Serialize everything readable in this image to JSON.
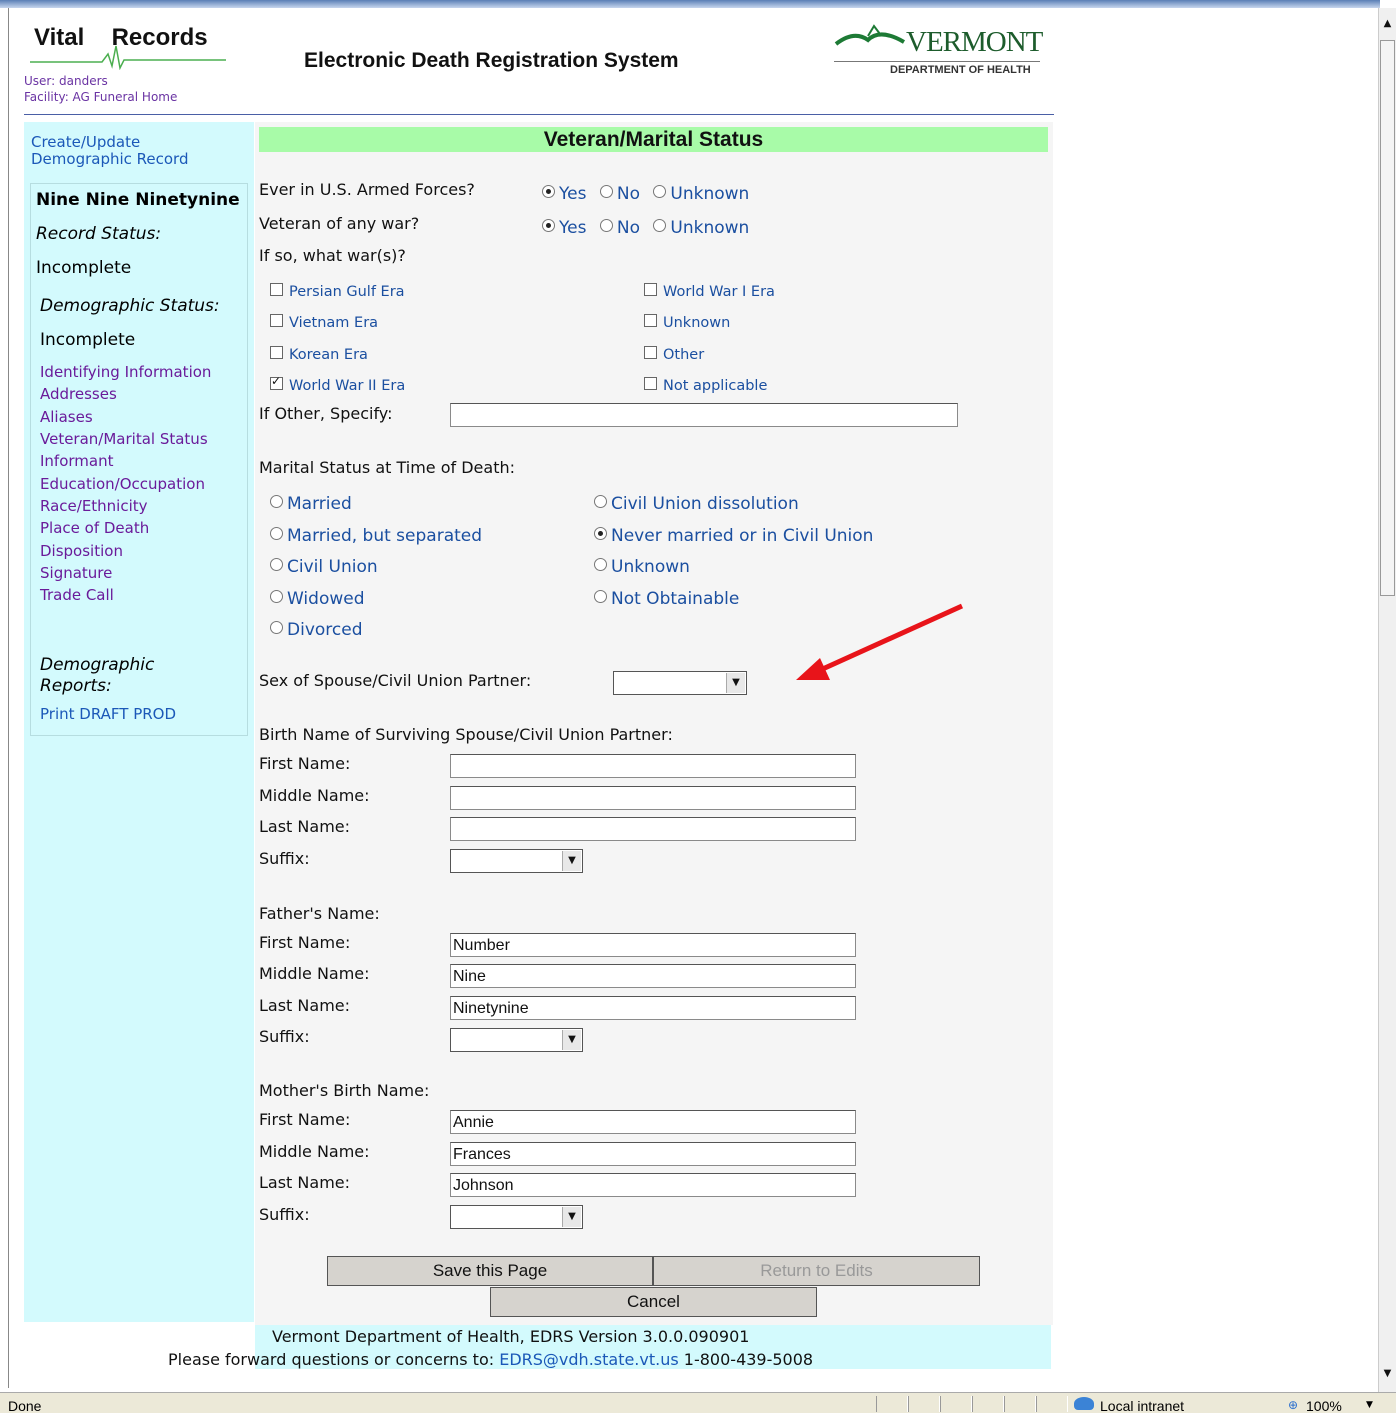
{
  "header": {
    "logo_left": "Vital",
    "logo_right": "Records",
    "user_line": "User: danders",
    "facility_line": "Facility: AG Funeral Home",
    "system_title": "Electronic Death Registration System",
    "state_name": "VERMONT",
    "department": "DEPARTMENT OF HEALTH"
  },
  "sidebar": {
    "create_link_1": "Create/Update",
    "create_link_2": "Demographic Record",
    "decedent_name": "Nine Nine Ninetynine",
    "record_status_label": "Record Status:",
    "record_status_value": "Incomplete",
    "demo_status_label": "Demographic Status:",
    "demo_status_value": "Incomplete",
    "nav": [
      "Identifying Information",
      "Addresses",
      "Aliases",
      "Veteran/Marital Status",
      "Informant",
      "Education/Occupation",
      "Race/Ethnicity",
      "Place of Death",
      "Disposition",
      "Signature",
      "Trade Call"
    ],
    "reports_label_1": "Demographic",
    "reports_label_2": "Reports:",
    "print_link": "Print DRAFT PROD"
  },
  "form": {
    "section_title": "Veteran/Marital Status",
    "armed_forces_label": "Ever in U.S. Armed Forces?",
    "veteran_label": "Veteran of any war?",
    "yes": "Yes",
    "no": "No",
    "unknown": "Unknown",
    "wars_label": "If so, what war(s)?",
    "wars": [
      {
        "label": "Persian Gulf Era",
        "checked": false
      },
      {
        "label": "Vietnam Era",
        "checked": false
      },
      {
        "label": "Korean Era",
        "checked": false
      },
      {
        "label": "World War II Era",
        "checked": true
      },
      {
        "label": "World War I Era",
        "checked": false
      },
      {
        "label": "Unknown",
        "checked": false
      },
      {
        "label": "Other",
        "checked": false
      },
      {
        "label": "Not applicable",
        "checked": false
      }
    ],
    "other_specify_label": "If Other, Specify:",
    "other_specify_value": "",
    "marital_label": "Marital Status at Time of Death:",
    "marital_options": [
      "Married",
      "Married, but separated",
      "Civil Union",
      "Widowed",
      "Divorced",
      "Civil Union dissolution",
      "Never married or in Civil Union",
      "Unknown",
      "Not Obtainable"
    ],
    "marital_selected": "Never married or in Civil Union",
    "spouse_sex_label": "Sex of Spouse/Civil Union Partner:",
    "spouse_sex_value": "",
    "spouse_birth_name_label": "Birth Name of Surviving Spouse/Civil Union Partner:",
    "first_name_label": "First Name:",
    "middle_name_label": "Middle Name:",
    "last_name_label": "Last Name:",
    "suffix_label": "Suffix:",
    "spouse": {
      "first": "",
      "middle": "",
      "last": "",
      "suffix": ""
    },
    "father_label": "Father's Name:",
    "father": {
      "first": "Number",
      "middle": "Nine",
      "last": "Ninetynine",
      "suffix": ""
    },
    "mother_label": "Mother's Birth Name:",
    "mother": {
      "first": "Annie",
      "middle": "Frances",
      "last": "Johnson",
      "suffix": ""
    },
    "save_button": "Save this Page",
    "return_button": "Return to Edits",
    "cancel_button": "Cancel"
  },
  "footer": {
    "line1": "Vermont Department of Health, EDRS Version 3.0.0.090901",
    "line2_prefix": "Please forward questions or concerns to:",
    "email": "EDRS@vdh.state.vt.us",
    "phone": "1-800-439-5008"
  },
  "statusbar": {
    "status": "Done",
    "zone": "Local intranet",
    "zoom": "100%"
  },
  "colors": {
    "sidebar_bg": "#d3fafd",
    "title_bar": "#a8fba8",
    "link_purple": "#6a1b9a",
    "link_blue": "#1b58b8",
    "annotation_arrow": "#e8141a"
  }
}
